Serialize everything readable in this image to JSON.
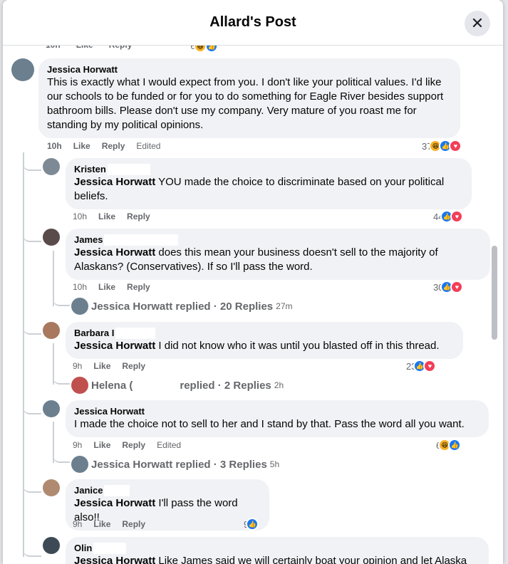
{
  "modal": {
    "title": "Allard's Post",
    "close_icon": "close-icon"
  },
  "top_partial": {
    "time": "10h",
    "like": "Like",
    "reply": "Reply",
    "count": "6"
  },
  "comments": [
    {
      "author": "Jessica Horwatt",
      "text": "This is exactly what I would expect from you. I don't like your political values. I'd like our schools to be funded or for you to do something for Eagle River besides support bathroom bills. Please don't use my company. Very mature of you roast me for standing by my political opinions.",
      "time": "10h",
      "like": "Like",
      "reply": "Reply",
      "edited": "Edited",
      "count": "37",
      "avatar_color": "#6b7f8f"
    },
    {
      "author": "Kristen",
      "tag": "Jessica Horwatt",
      "text": " YOU made the choice to discriminate based on your political beliefs.",
      "time": "10h",
      "like": "Like",
      "reply": "Reply",
      "count": "44",
      "avatar_color": "#7d8a96"
    },
    {
      "author": "James",
      "tag": "Jessica Horwatt",
      "text": " does this mean your business doesn't sell to the majority of Alaskans? (Conservatives). If so I'll pass the word.",
      "time": "10h",
      "like": "Like",
      "reply": "Reply",
      "count": "30",
      "avatar_color": "#5a4b4b",
      "replies": {
        "name": "Jessica Horwatt replied",
        "count": "20 Replies",
        "ago": "27m"
      }
    },
    {
      "author": "Barbara I",
      "tag": "Jessica Horwatt",
      "text": " I did not know who it was until you blasted off in this thread.",
      "time": "9h",
      "like": "Like",
      "reply": "Reply",
      "count": "23",
      "avatar_color": "#a8785f",
      "replies": {
        "name": "Helena (",
        "suffix": "replied",
        "count": "2 Replies",
        "ago": "2h"
      }
    },
    {
      "author": "Jessica Horwatt",
      "text": "I made the choice not to sell to her and I stand by that. Pass the word all you want.",
      "time": "9h",
      "like": "Like",
      "reply": "Reply",
      "edited": "Edited",
      "count": "6",
      "avatar_color": "#6b7f8f",
      "replies": {
        "name": "Jessica Horwatt replied",
        "count": "3 Replies",
        "ago": "5h"
      }
    },
    {
      "author": "Janice",
      "tag": "Jessica Horwatt",
      "text": " I'll pass the word also!!",
      "time": "9h",
      "like": "Like",
      "reply": "Reply",
      "count": "9",
      "avatar_color": "#b08a70"
    },
    {
      "author": "Olin",
      "tag": "Jessica Horwatt",
      "text": " Like James said we will certainly boat your opinion and let Alaska",
      "avatar_color": "#3d4a55"
    }
  ],
  "colors": {
    "like": "#1877f2",
    "love": "#f33e58",
    "haha": "#f7b125",
    "bubble": "#f0f2f5"
  }
}
